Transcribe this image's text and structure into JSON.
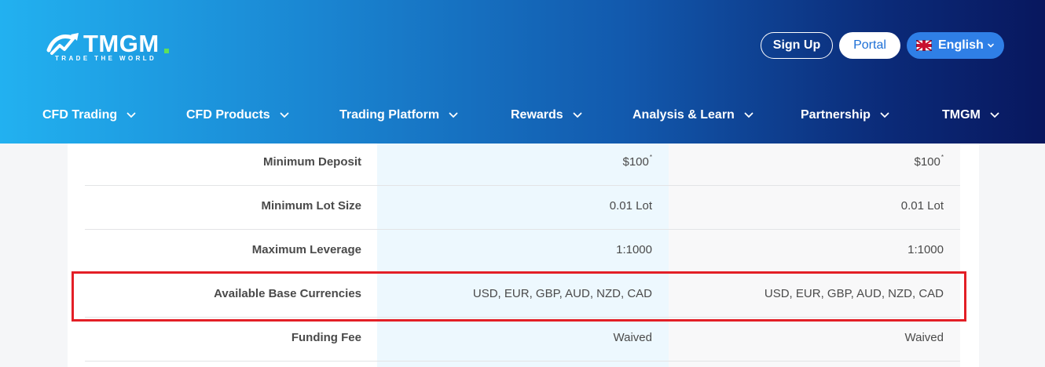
{
  "header": {
    "logo_text": "TMGM",
    "logo_tagline": "TRADE THE WORLD",
    "signup_label": "Sign Up",
    "portal_label": "Portal",
    "language_label": "English",
    "nav": [
      {
        "label": "CFD Trading"
      },
      {
        "label": "CFD Products"
      },
      {
        "label": "Trading Platform"
      },
      {
        "label": "Rewards"
      },
      {
        "label": "Analysis & Learn"
      },
      {
        "label": "Partnership"
      },
      {
        "label": "TMGM"
      }
    ]
  },
  "table": {
    "rows": [
      {
        "label": "Minimum Deposit",
        "v1": "$100",
        "v2": "$100",
        "v1_sup": "*",
        "v2_sup": "*"
      },
      {
        "label": "Minimum Lot Size",
        "v1": "0.01 Lot",
        "v2": "0.01 Lot"
      },
      {
        "label": "Maximum Leverage",
        "v1": "1:1000",
        "v2": "1:1000"
      },
      {
        "label": "Available Base Currencies",
        "v1": "USD, EUR, GBP, AUD, NZD, CAD",
        "v2": "USD, EUR, GBP, AUD, NZD, CAD"
      },
      {
        "label": "Funding Fee",
        "v1": "Waived",
        "v2": "Waived"
      }
    ]
  },
  "colors": {
    "highlight_border": "#e31f26",
    "accent_blue": "#1c6fd6",
    "header_gradient_start": "#22b1f0",
    "header_gradient_end": "#08175e"
  }
}
